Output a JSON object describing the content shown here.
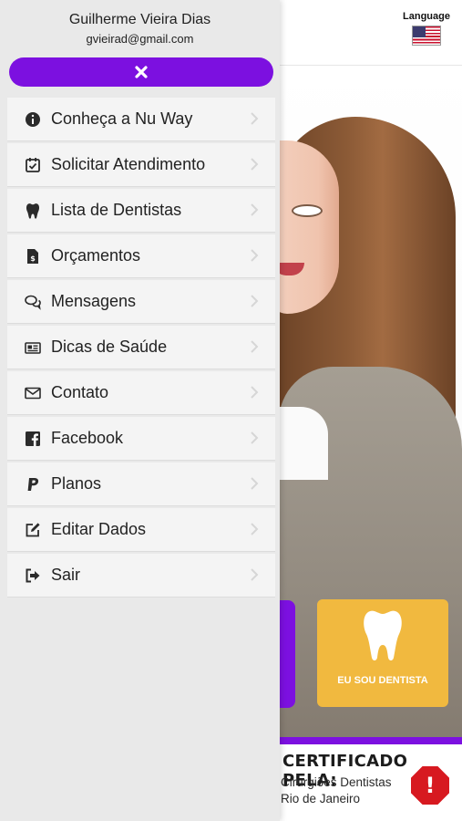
{
  "header": {
    "language_label": "Language",
    "language_flag": "us-flag-icon"
  },
  "drawer": {
    "user_name": "Guilherme Vieira Dias",
    "user_email": "gvieirad@gmail.com",
    "close_icon": "close-icon",
    "accent_color": "#7c10e0",
    "items": [
      {
        "label": "Conheça a Nu Way",
        "icon": "info-icon"
      },
      {
        "label": "Solicitar Atendimento",
        "icon": "calendar-check-icon"
      },
      {
        "label": "Lista de Dentistas",
        "icon": "tooth-icon"
      },
      {
        "label": "Orçamentos",
        "icon": "invoice-dollar-icon"
      },
      {
        "label": "Mensagens",
        "icon": "chat-bubbles-icon"
      },
      {
        "label": "Dicas de Saúde",
        "icon": "newspaper-icon"
      },
      {
        "label": "Contato",
        "icon": "envelope-icon"
      },
      {
        "label": "Facebook",
        "icon": "facebook-icon"
      },
      {
        "label": "Planos",
        "icon": "paypal-icon"
      },
      {
        "label": "Editar Dados",
        "icon": "edit-icon"
      },
      {
        "label": "Sair",
        "icon": "sign-out-icon"
      }
    ]
  },
  "background": {
    "dentist_button_label": "EU SOU DENTISTA",
    "dentist_button_color": "#f1b93f",
    "certified_title": "CERTIFICADO PELA:",
    "certified_line1": "Cirurgiões Dentistas",
    "certified_line2": "Rio de Janeiro",
    "alert_icon": "alert-octagon-icon",
    "alert_symbol": "!"
  }
}
